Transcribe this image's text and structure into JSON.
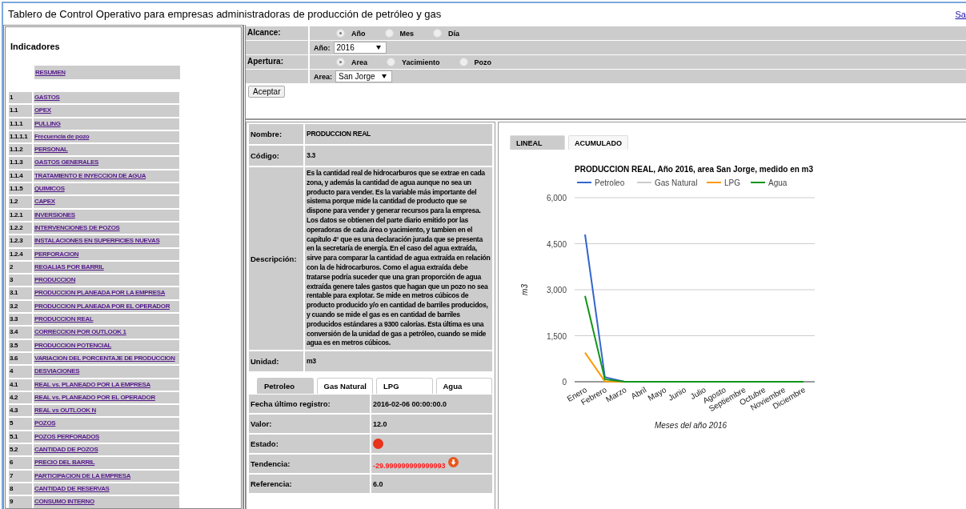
{
  "header": {
    "title": "Tablero de Control Operativo para empresas administradoras de producción de petróleo y gas",
    "link": "Sa"
  },
  "sidebar": {
    "heading": "Indicadores",
    "summary_link": "RESUMEN",
    "items": [
      {
        "number": "1",
        "label": "GASTOS"
      },
      {
        "number": "1.1",
        "label": "OPEX"
      },
      {
        "number": "1.1.1",
        "label": "PULLING"
      },
      {
        "number": "1.1.1.1",
        "label": "Frecuencia de pozo"
      },
      {
        "number": "1.1.2",
        "label": "PERSONAL"
      },
      {
        "number": "1.1.3",
        "label": "GASTOS GENERALES"
      },
      {
        "number": "1.1.4",
        "label": "TRATAMIENTO E INYECCION DE AGUA"
      },
      {
        "number": "1.1.5",
        "label": "QUIMICOS"
      },
      {
        "number": "1.2",
        "label": "CAPEX"
      },
      {
        "number": "1.2.1",
        "label": "INVERSIONES"
      },
      {
        "number": "1.2.2",
        "label": "INTERVENCIONES DE POZOS"
      },
      {
        "number": "1.2.3",
        "label": "INSTALACIONES EN SUPERFICIES NUEVAS"
      },
      {
        "number": "1.2.4",
        "label": "PERFORACION"
      },
      {
        "number": "2",
        "label": "REGALIAS POR BARRIL"
      },
      {
        "number": "3",
        "label": "PRODUCCION"
      },
      {
        "number": "3.1",
        "label": "PRODUCCION PLANEADA POR LA EMPRESA"
      },
      {
        "number": "3.2",
        "label": "PRODUCCION PLANEADA POR EL OPERADOR"
      },
      {
        "number": "3.3",
        "label": "PRODUCCION REAL"
      },
      {
        "number": "3.4",
        "label": "CORRECCION POR OUTLOOK 1"
      },
      {
        "number": "3.5",
        "label": "PRODUCCION POTENCIAL"
      },
      {
        "number": "3.6",
        "label": "VARIACION DEL PORCENTAJE DE PRODUCCION"
      },
      {
        "number": "4",
        "label": "DESVIACIONES"
      },
      {
        "number": "4.1",
        "label": "REAL vs. PLANEADO POR LA EMPRESA"
      },
      {
        "number": "4.2",
        "label": "REAL vs. PLANEADO POR EL OPERADOR"
      },
      {
        "number": "4.3",
        "label": "REAL vs OUTLOOK N"
      },
      {
        "number": "5",
        "label": "POZOS"
      },
      {
        "number": "5.1",
        "label": "POZOS PERFORADOS"
      },
      {
        "number": "5.2",
        "label": "CANTIDAD DE POZOS"
      },
      {
        "number": "6",
        "label": "PRECIO DEL BARRIL"
      },
      {
        "number": "7",
        "label": "PARTICIPACION DE LA EMPRESA"
      },
      {
        "number": "8",
        "label": "CANTIDAD DE RESERVAS"
      },
      {
        "number": "9",
        "label": "CONSUMO INTERNO"
      }
    ]
  },
  "filters": [
    {
      "kind": "radio",
      "label": "Alcance:",
      "options": [
        {
          "label": "Año",
          "selected": true
        },
        {
          "label": "Mes",
          "selected": false
        },
        {
          "label": "Día",
          "selected": false
        }
      ]
    },
    {
      "kind": "select",
      "field_label": "Año:",
      "value": "2016"
    },
    {
      "kind": "radio",
      "label": "Apertura:",
      "options": [
        {
          "label": "Area",
          "selected": true
        },
        {
          "label": "Yacimiento",
          "selected": false
        },
        {
          "label": "Pozo",
          "selected": false
        }
      ]
    },
    {
      "kind": "select",
      "field_label": "Area:",
      "value": "San Jorge"
    }
  ],
  "accept_button": "Aceptar",
  "indicator": {
    "fields": [
      {
        "label": "Nombre:",
        "value": "PRODUCCION REAL"
      },
      {
        "label": "Código:",
        "value": "3.3"
      },
      {
        "label": "Descripción:",
        "value": "Es la cantidad real de hidrocarburos que se extrae en cada zona, y además la cantidad de agua aunque no sea un producto para vender. Es la variable más importante del sistema porque mide la cantidad de producto que se dispone para vender y generar recursos para la empresa. Los datos se obtienen del parte diario emitido por las operadoras de cada área o yacimiento, y tambien en el capítulo 4° que es una declaración jurada que se presenta en la secretaría de energía. En el caso del agua extraída, sirve para comparar la cantidad de agua extraída en relación con la de hidrocarburos. Como el agua extraída debe tratarse podría suceder que una gran proporción de agua extraída genere tales gastos que hagan que un pozo no sea rentable para explotar. Se mide en metros cúbicos de producto producido y/o en cantidad de barriles producidos, y cuando se mide el gas es en cantidad de barriles producidos estándares a 9300 calorías. Esta última es una conversión de la unidad de gas a petróleo, cuando se mide agua es en metros cúbicos."
      },
      {
        "label": "Unidad:",
        "value": "m3"
      }
    ],
    "product_tabs": [
      {
        "label": "Petroleo",
        "selected": true
      },
      {
        "label": "Gas Natural",
        "selected": false
      },
      {
        "label": "LPG",
        "selected": false
      },
      {
        "label": "Agua",
        "selected": false
      }
    ],
    "metrics": [
      {
        "kind": "text",
        "label": "Fecha último registro:",
        "value": "2016-02-06 00:00:00.0"
      },
      {
        "kind": "text",
        "label": "Valor:",
        "value": "12.0"
      },
      {
        "kind": "status",
        "label": "Estado:",
        "color": "#e8321c"
      },
      {
        "kind": "trend_down",
        "label": "Tendencia:",
        "value": "-29.999999999999993"
      },
      {
        "kind": "text",
        "label": "Referencia:",
        "value": "6.0"
      }
    ]
  },
  "chart": {
    "tabs": [
      {
        "label": "LINEAL",
        "selected": true
      },
      {
        "label": "ACUMULADO",
        "selected": false
      }
    ],
    "chart_data": {
      "type": "line",
      "title": "PRODUCCION REAL, Año 2016, area San Jorge, medido en m3",
      "xlabel": "Meses del año 2016",
      "ylabel": "m3",
      "categories": [
        "Enero",
        "Febrero",
        "Marzo",
        "Abril",
        "Mayo",
        "Junio",
        "Julio",
        "Agosto",
        "Septiembre",
        "Octubre",
        "Noviembre",
        "Diciembre"
      ],
      "series": [
        {
          "name": "Petroleo",
          "color": "#3366cc",
          "values": [
            4800,
            150,
            0,
            null,
            null,
            null,
            null,
            null,
            null,
            null,
            null,
            null
          ]
        },
        {
          "name": "Gas Natural",
          "color": "#cccccc",
          "values": [
            null,
            null,
            null,
            null,
            null,
            null,
            null,
            null,
            null,
            null,
            null,
            null
          ]
        },
        {
          "name": "LPG",
          "color": "#ff9900",
          "values": [
            950,
            10,
            0,
            null,
            null,
            null,
            null,
            null,
            null,
            null,
            null,
            null
          ]
        },
        {
          "name": "Agua",
          "color": "#109618",
          "values": [
            2800,
            80,
            0,
            0,
            0,
            0,
            0,
            0,
            0,
            0,
            0,
            0
          ]
        }
      ],
      "legend": true,
      "grid": true,
      "ylim": [
        0,
        6000
      ],
      "yticks": [
        {
          "value": 0,
          "label": "0"
        },
        {
          "value": 1500,
          "label": "1,500"
        },
        {
          "value": 3000,
          "label": "3,000"
        },
        {
          "value": 4500,
          "label": "4,500"
        },
        {
          "value": 6000,
          "label": "6,000"
        }
      ]
    }
  }
}
